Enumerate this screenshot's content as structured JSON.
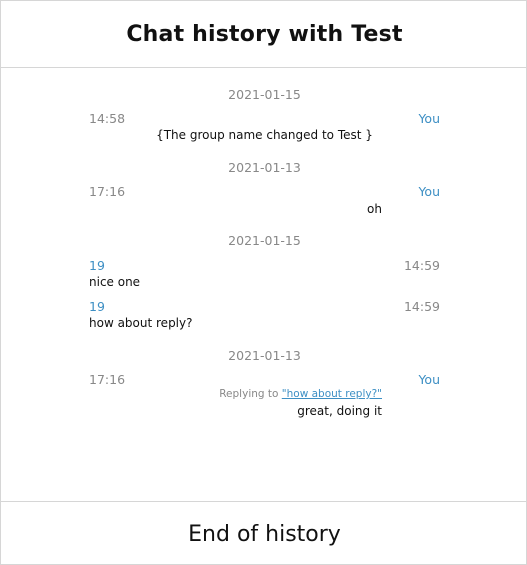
{
  "header": {
    "title": "Chat history with Test"
  },
  "footer": {
    "label": "End of history"
  },
  "history": {
    "date_1": "2021-01-15",
    "msg_1": {
      "time": "14:58",
      "sender": "You",
      "text": "{The group name changed to Test }"
    },
    "date_2": "2021-01-13",
    "msg_2": {
      "time": "17:16",
      "sender": "You",
      "text": "oh"
    },
    "date_3": "2021-01-15",
    "msg_3": {
      "sender": "19",
      "time": "14:59",
      "text": "nice one"
    },
    "msg_4": {
      "sender": "19",
      "time": "14:59",
      "text": "how about reply?"
    },
    "date_4": "2021-01-13",
    "msg_5": {
      "time": "17:16",
      "sender": "You",
      "reply_prefix": "Replying to ",
      "reply_link": "\"how about reply?\"",
      "text": "great, doing it"
    }
  }
}
